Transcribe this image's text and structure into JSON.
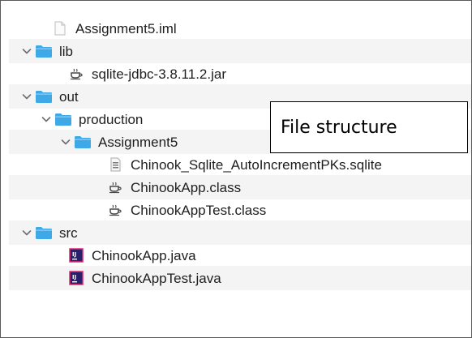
{
  "tree": {
    "items": [
      {
        "label": "Assignment5.iml",
        "icon": "file-icon"
      },
      {
        "label": "lib",
        "icon": "folder-icon",
        "expanded": true
      },
      {
        "label": "sqlite-jdbc-3.8.11.2.jar",
        "icon": "jar-icon"
      },
      {
        "label": "out",
        "icon": "folder-icon",
        "expanded": true
      },
      {
        "label": "production",
        "icon": "folder-icon",
        "expanded": true
      },
      {
        "label": "Assignment5",
        "icon": "folder-icon",
        "expanded": true
      },
      {
        "label": "Chinook_Sqlite_AutoIncrementPKs.sqlite",
        "icon": "database-file-icon"
      },
      {
        "label": "ChinookApp.class",
        "icon": "class-file-icon"
      },
      {
        "label": "ChinookAppTest.class",
        "icon": "class-file-icon"
      },
      {
        "label": "src",
        "icon": "folder-icon",
        "expanded": true
      },
      {
        "label": "ChinookApp.java",
        "icon": "java-file-icon"
      },
      {
        "label": "ChinookAppTest.java",
        "icon": "java-file-icon"
      }
    ]
  },
  "callout": {
    "text": "File structure"
  },
  "colors": {
    "folder": "#3fa9e8",
    "stripe": "#f4f4f5",
    "text": "#1e1e1e",
    "java_badge": "#2a1f6b"
  }
}
